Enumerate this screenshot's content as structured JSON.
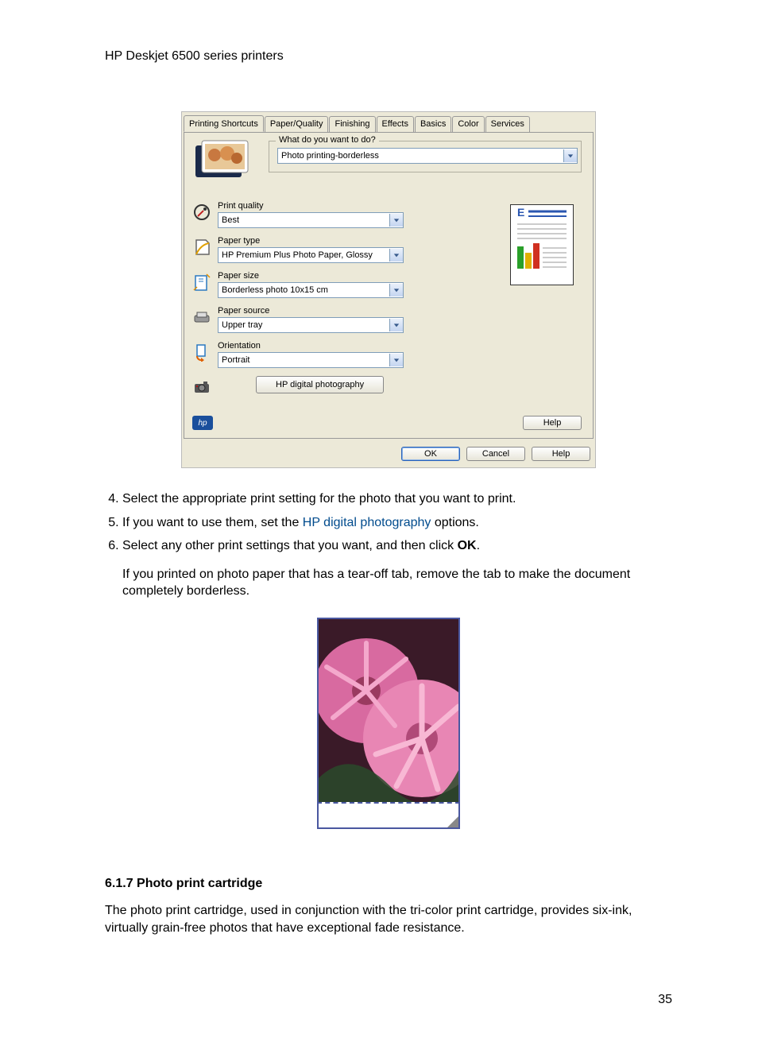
{
  "header": {
    "title": "HP Deskjet 6500 series printers"
  },
  "dialog": {
    "tabs": [
      "Printing Shortcuts",
      "Paper/Quality",
      "Finishing",
      "Effects",
      "Basics",
      "Color",
      "Services"
    ],
    "active_tab_index": 0,
    "task": {
      "legend": "What do you want to do?",
      "value": "Photo printing-borderless"
    },
    "options": {
      "print_quality": {
        "label": "Print quality",
        "value": "Best"
      },
      "paper_type": {
        "label": "Paper type",
        "value": "HP Premium Plus Photo Paper, Glossy"
      },
      "paper_size": {
        "label": "Paper size",
        "value": "Borderless photo 10x15 cm"
      },
      "paper_source": {
        "label": "Paper source",
        "value": "Upper tray"
      },
      "orientation": {
        "label": "Orientation",
        "value": "Portrait"
      }
    },
    "hp_photo_button": "HP digital photography",
    "help_button_inner": "Help",
    "buttons": {
      "ok": "OK",
      "cancel": "Cancel",
      "help": "Help"
    },
    "hp_logo_text": "hp"
  },
  "steps": {
    "start": 4,
    "s4": "Select the appropriate print setting for the photo that you want to print.",
    "s5_a": "If you want to use them, set the ",
    "s5_link": "HP digital photography",
    "s5_b": " options.",
    "s6_a": "Select any other print settings that you want, and then click ",
    "s6_bold": "OK",
    "s6_b": ".",
    "s6_sub": "If you printed on photo paper that has a tear-off tab, remove the tab to make the document completely borderless."
  },
  "section": {
    "heading": "6.1.7  Photo print cartridge",
    "para": "The photo print cartridge, used in conjunction with the tri-color print cartridge, provides six-ink, virtually grain-free photos that have exceptional fade resistance."
  },
  "page_number": "35"
}
